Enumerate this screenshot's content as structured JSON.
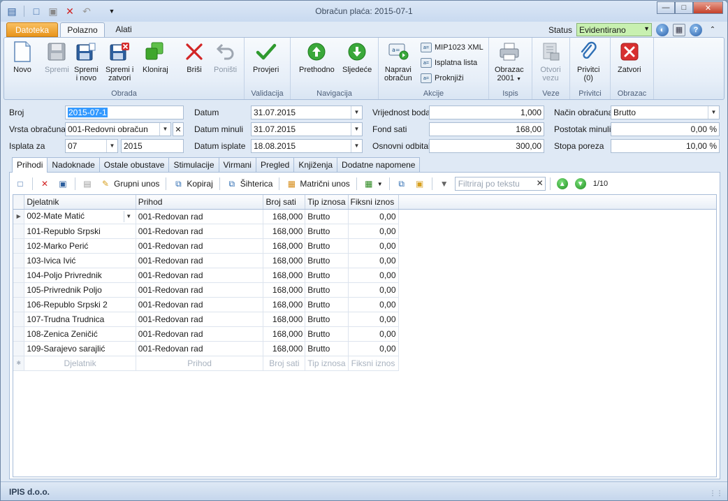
{
  "window": {
    "title": "Obračun plaća: 2015-07-1"
  },
  "ribbon_tabs": {
    "file": "Datoteka",
    "home": "Polazno",
    "tools": "Alati"
  },
  "status": {
    "label": "Status",
    "value": "Evidentirano"
  },
  "groups": {
    "obrada": "Obrada",
    "validacija": "Validacija",
    "navigacija": "Navigacija",
    "akcije": "Akcije",
    "ispis": "Ispis",
    "veze": "Veze",
    "privitci": "Privitci",
    "obrazac": "Obrazac"
  },
  "buttons": {
    "novo": "Novo",
    "spremi": "Spremi",
    "spremi_novo_1": "Spremi",
    "spremi_novo_2": "i novo",
    "spremi_zatvori_1": "Spremi i",
    "spremi_zatvori_2": "zatvori",
    "kloniraj": "Kloniraj",
    "brisi": "Briši",
    "ponisti": "Poništi",
    "provjeri": "Provjeri",
    "prethodno": "Prethodno",
    "sljedece": "Sljedeće",
    "napravi_1": "Napravi",
    "napravi_2": "obračun",
    "mip": "MIP1023 XML",
    "isplatna": "Isplatna lista",
    "proknjizi": "Proknjiži",
    "obrazac_1": "Obrazac",
    "obrazac_2": "2001",
    "otvori_1": "Otvori",
    "otvori_2": "vezu",
    "privitci_1": "Privitci",
    "privitci_2": "(0)",
    "zatvori": "Zatvori"
  },
  "form": {
    "broj": {
      "label": "Broj",
      "value": "2015-07-1"
    },
    "vrsta": {
      "label": "Vrsta obračuna",
      "value": "001-Redovni obračun"
    },
    "isplata": {
      "label": "Isplata za",
      "month": "07",
      "year": "2015"
    },
    "datum": {
      "label": "Datum",
      "value": "31.07.2015"
    },
    "datum_minuli": {
      "label": "Datum minuli",
      "value": "31.07.2015"
    },
    "datum_isplate": {
      "label": "Datum isplate",
      "value": "18.08.2015"
    },
    "vrijednost_boda": {
      "label": "Vrijednost boda",
      "value": "1,000"
    },
    "fond_sati": {
      "label": "Fond sati",
      "value": "168,00"
    },
    "osnovni_odbitak": {
      "label": "Osnovni odbitak",
      "value": "300,00"
    },
    "nacin": {
      "label": "Način obračuna",
      "value": "Brutto"
    },
    "postotak_minuli": {
      "label": "Postotak minuli",
      "value": "0,00 %"
    },
    "stopa_poreza": {
      "label": "Stopa poreza",
      "value": "10,00 %"
    }
  },
  "subtabs": [
    "Prihodi",
    "Nadoknade",
    "Ostale obustave",
    "Stimulacije",
    "Virmani",
    "Pregled",
    "Knjiženja",
    "Dodatne napomene"
  ],
  "toolbar": {
    "grupni": "Grupni unos",
    "kopiraj": "Kopiraj",
    "sihterica": "Šihterica",
    "matricni": "Matrični unos",
    "filter_placeholder": "Filtriraj po tekstu",
    "pager": "1/10"
  },
  "grid": {
    "columns": [
      "Djelatnik",
      "Prihod",
      "Broj sati",
      "Tip iznosa",
      "Fiksni iznos"
    ],
    "rows": [
      [
        "002-Mate Matić",
        "001-Redovan rad",
        "168,000",
        "Brutto",
        "0,00"
      ],
      [
        "101-Republo Srpski",
        "001-Redovan rad",
        "168,000",
        "Brutto",
        "0,00"
      ],
      [
        "102-Marko Perić",
        "001-Redovan rad",
        "168,000",
        "Brutto",
        "0,00"
      ],
      [
        "103-Ivica Ivić",
        "001-Redovan rad",
        "168,000",
        "Brutto",
        "0,00"
      ],
      [
        "104-Poljo Privrednik",
        "001-Redovan rad",
        "168,000",
        "Brutto",
        "0,00"
      ],
      [
        "105-Privrednik Poljo",
        "001-Redovan rad",
        "168,000",
        "Brutto",
        "0,00"
      ],
      [
        "106-Republo Srpski 2",
        "001-Redovan rad",
        "168,000",
        "Brutto",
        "0,00"
      ],
      [
        "107-Trudna Trudnica",
        "001-Redovan rad",
        "168,000",
        "Brutto",
        "0,00"
      ],
      [
        "108-Zenica Zeničić",
        "001-Redovan rad",
        "168,000",
        "Brutto",
        "0,00"
      ],
      [
        "109-Sarajevo sarajlić",
        "001-Redovan rad",
        "168,000",
        "Brutto",
        "0,00"
      ]
    ],
    "new_row": [
      "Djelatnik",
      "Prihod",
      "Broj sati",
      "Tip iznosa",
      "Fiksni iznos"
    ]
  },
  "statusbar": {
    "company": "IPIS d.o.o."
  }
}
